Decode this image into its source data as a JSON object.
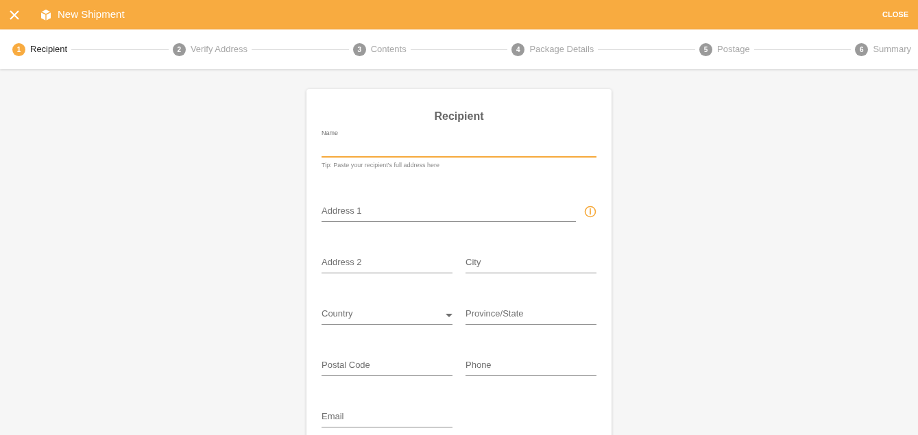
{
  "header": {
    "title": "New Shipment",
    "close_label": "CLOSE"
  },
  "steps": [
    {
      "number": "1",
      "label": "Recipient",
      "selected": true
    },
    {
      "number": "2",
      "label": "Verify Address",
      "selected": false
    },
    {
      "number": "3",
      "label": "Contents",
      "selected": false
    },
    {
      "number": "4",
      "label": "Package Details",
      "selected": false
    },
    {
      "number": "5",
      "label": "Postage",
      "selected": false
    },
    {
      "number": "6",
      "label": "Summary",
      "selected": false
    }
  ],
  "form": {
    "title": "Recipient",
    "rows": [
      [
        {
          "kind": "text",
          "label": "Name",
          "focused": true,
          "hint": "Tip: Paste your recipient's full address here"
        }
      ],
      [
        {
          "kind": "text",
          "label": "Address 1",
          "focused": false,
          "info": true
        }
      ],
      [
        {
          "kind": "text",
          "label": "Address 2",
          "focused": false
        },
        {
          "kind": "text",
          "label": "City",
          "focused": false
        }
      ],
      [
        {
          "kind": "select",
          "label": "Country",
          "focused": false
        },
        {
          "kind": "text",
          "label": "Province/State",
          "focused": false
        }
      ],
      [
        {
          "kind": "text",
          "label": "Postal Code",
          "focused": false
        },
        {
          "kind": "text",
          "label": "Phone",
          "focused": false
        }
      ],
      [
        {
          "kind": "text",
          "label": "Email",
          "focused": false
        }
      ]
    ]
  }
}
